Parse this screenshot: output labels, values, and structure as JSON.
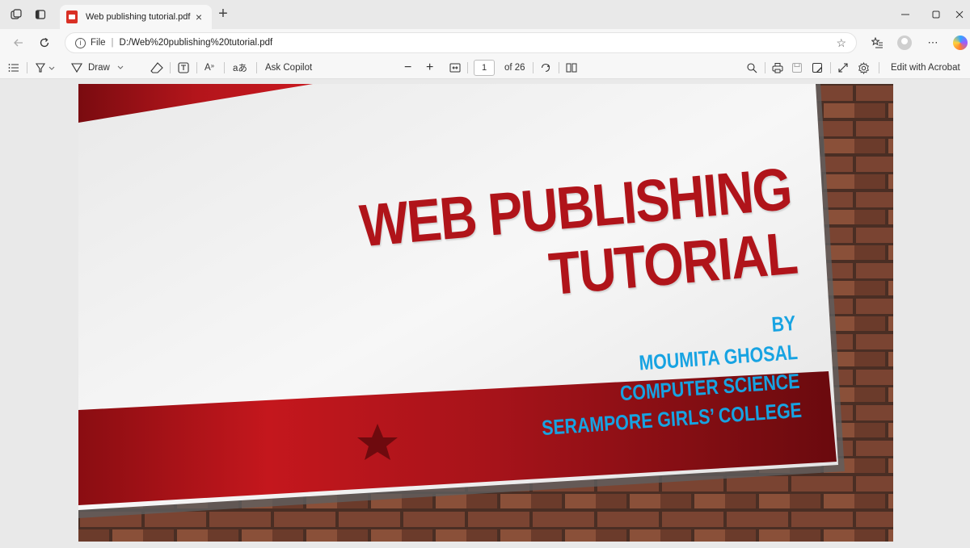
{
  "tab": {
    "title": "Web publishing tutorial.pdf",
    "close": "×",
    "new_tab": "+"
  },
  "address": {
    "scheme_label": "File",
    "url": "D:/Web%20publishing%20tutorial.pdf"
  },
  "pdf_toolbar": {
    "draw_label": "Draw",
    "ask_copilot_label": "Ask Copilot",
    "page_number": "1",
    "page_count_label": "of 26",
    "edit_label": "Edit with Acrobat",
    "read_aloud_glyph": "A",
    "translate_glyph": "aあ"
  },
  "slide": {
    "title_lines": [
      "WEB PUBLISHING",
      "TUTORIAL"
    ],
    "byline": [
      "BY",
      "MOUMITA GHOSAL",
      "COMPUTER SCIENCE",
      "SERAMPORE GIRLS’ COLLEGE"
    ]
  },
  "colors": {
    "title_red": "#b0141a",
    "byline_blue": "#17a3e2",
    "band_red": "#a9131b"
  },
  "icons": [
    "workspaces-icon",
    "tab-actions-icon",
    "pdf-file-icon",
    "back-icon",
    "refresh-icon",
    "info-icon",
    "favorite-star-icon",
    "favorites-icon",
    "profile-icon",
    "more-icon",
    "copilot-icon",
    "contents-icon",
    "highlight-icon",
    "erase-icon",
    "text-box-icon",
    "read-aloud-icon",
    "zoom-out-icon",
    "zoom-in-icon",
    "fit-page-icon",
    "rotate-icon",
    "page-view-icon",
    "search-icon",
    "print-icon",
    "save-icon",
    "save-as-icon",
    "fullscreen-icon",
    "settings-icon",
    "star-decoration"
  ]
}
